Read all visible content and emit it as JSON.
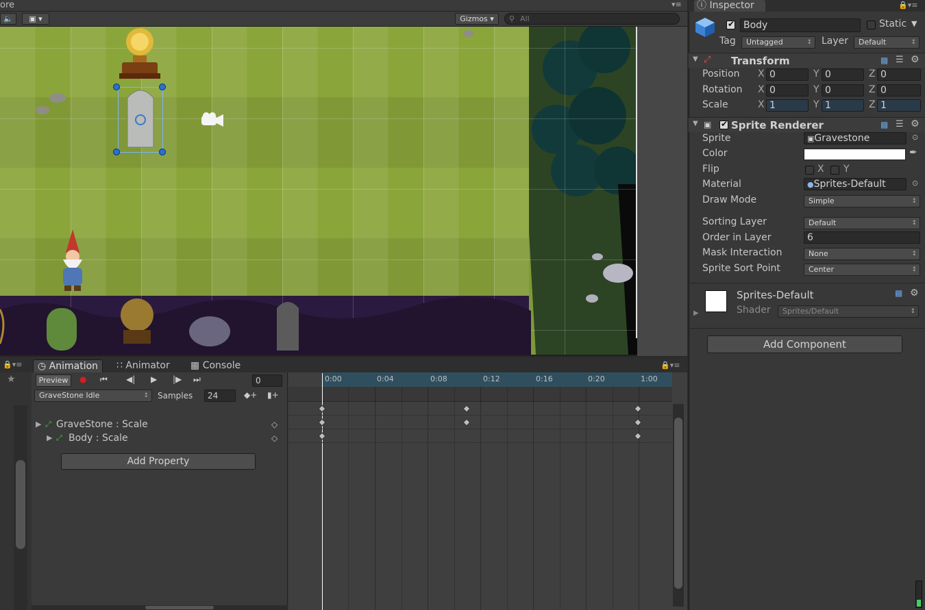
{
  "scene": {
    "tab_title": "ore",
    "gizmos_label": "Gizmos",
    "search_placeholder": "All"
  },
  "animation_panel": {
    "tabs": [
      {
        "label": "Animation",
        "active": true
      },
      {
        "label": "Animator",
        "active": false
      },
      {
        "label": "Console",
        "active": false
      }
    ],
    "preview_label": "Preview",
    "frame_value": "0",
    "clip_name": "GraveStone Idle",
    "samples_label": "Samples",
    "samples_value": "24",
    "properties": [
      {
        "label": "GraveStone : Scale"
      },
      {
        "label": "Body : Scale"
      }
    ],
    "add_property_label": "Add Property",
    "timeline_ticks": [
      "0:00",
      "0:04",
      "0:08",
      "0:12",
      "0:16",
      "0:20",
      "1:00"
    ]
  },
  "inspector": {
    "tab_title": "Inspector",
    "object_name": "Body",
    "static_label": "Static",
    "tag_label": "Tag",
    "tag_value": "Untagged",
    "layer_label": "Layer",
    "layer_value": "Default",
    "transform": {
      "title": "Transform",
      "rows": [
        {
          "label": "Position",
          "x": "0",
          "y": "0",
          "z": "0"
        },
        {
          "label": "Rotation",
          "x": "0",
          "y": "0",
          "z": "0"
        },
        {
          "label": "Scale",
          "x": "1",
          "y": "1",
          "z": "1"
        }
      ],
      "x_label": "X",
      "y_label": "Y",
      "z_label": "Z"
    },
    "sprite_renderer": {
      "title": "Sprite Renderer",
      "sprite_label": "Sprite",
      "sprite_value": "Gravestone",
      "color_label": "Color",
      "color_value": "#ffffff",
      "flip_label": "Flip",
      "flip_x": "X",
      "flip_y": "Y",
      "material_label": "Material",
      "material_value": "Sprites-Default",
      "draw_mode_label": "Draw Mode",
      "draw_mode_value": "Simple",
      "sorting_layer_label": "Sorting Layer",
      "sorting_layer_value": "Default",
      "order_label": "Order in Layer",
      "order_value": "6",
      "mask_label": "Mask Interaction",
      "mask_value": "None",
      "sort_point_label": "Sprite Sort Point",
      "sort_point_value": "Center"
    },
    "material": {
      "name": "Sprites-Default",
      "shader_label": "Shader",
      "shader_value": "Sprites/Default"
    },
    "add_component_label": "Add Component"
  },
  "colors": {
    "accent_blue": "#2a6fd8",
    "timeline_header": "#2f4f5f",
    "grass": "#8aa53a"
  }
}
